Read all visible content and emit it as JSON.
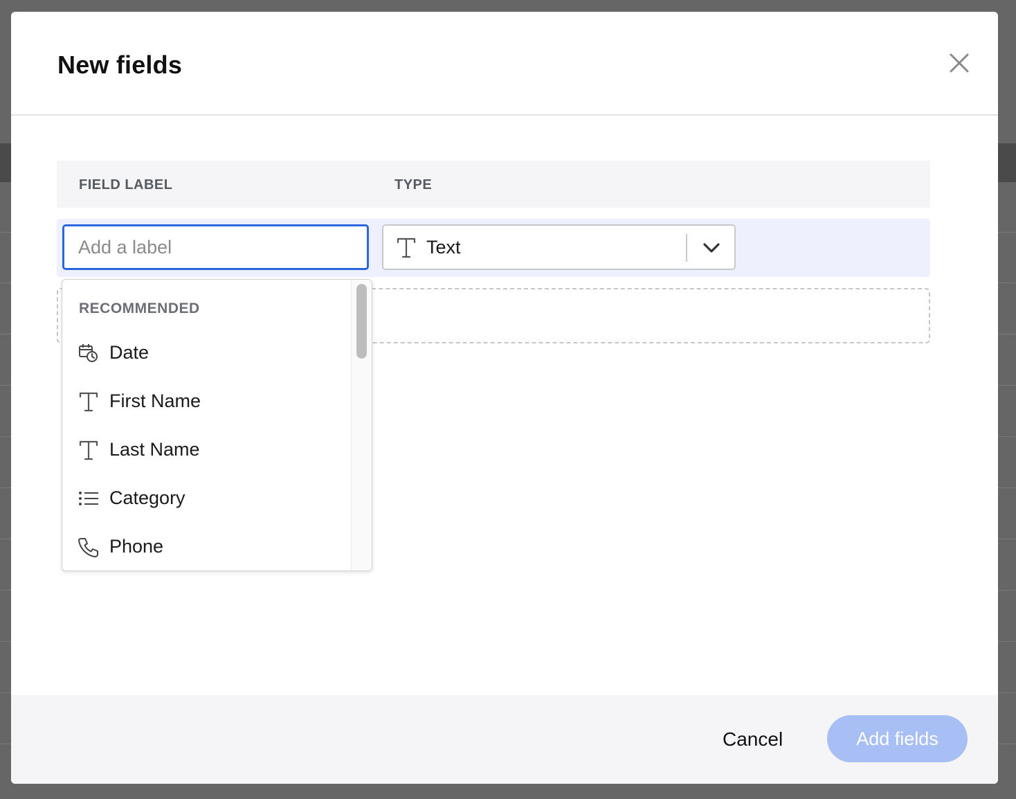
{
  "modal": {
    "title": "New fields"
  },
  "table": {
    "headers": {
      "field_label": "FIELD LABEL",
      "type": "TYPE"
    }
  },
  "row": {
    "label_placeholder": "Add a label",
    "label_value": "",
    "type_value": "Text",
    "type_icon": "text-type-icon"
  },
  "dropdown": {
    "heading": "RECOMMENDED",
    "items": [
      {
        "label": "Date",
        "icon": "calendar-clock-icon"
      },
      {
        "label": "First Name",
        "icon": "text-type-icon"
      },
      {
        "label": "Last Name",
        "icon": "text-type-icon"
      },
      {
        "label": "Category",
        "icon": "list-icon"
      },
      {
        "label": "Phone",
        "icon": "phone-icon"
      }
    ]
  },
  "footer": {
    "cancel_label": "Cancel",
    "add_label": "Add fields"
  },
  "colors": {
    "accent": "#2a66e0",
    "primary_disabled": "#a7bff5",
    "row_highlight": "#eef1fd"
  }
}
